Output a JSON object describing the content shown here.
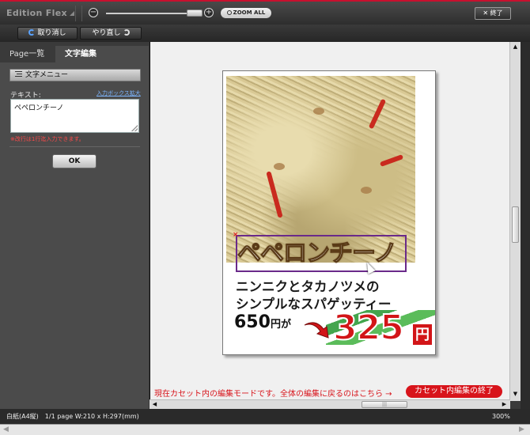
{
  "app": {
    "brand": "Edition Flex",
    "zoom_minus": "−",
    "zoom_plus": "+",
    "zoom_all_label": "ZOOM ALL",
    "exit_label": "✕ 終了"
  },
  "toolbar": {
    "undo_label": "取り消し",
    "redo_label": "やり直し"
  },
  "left_panel": {
    "tabs": [
      {
        "label": "Page一覧",
        "active": false
      },
      {
        "label": "文字編集",
        "active": true
      }
    ],
    "text_menu_label": "文字メニュー",
    "text_label": "テキスト:",
    "expand_link": "入力ボックス拡大",
    "text_value": "ペペロンチーノ",
    "note": "※改行は1行迄入力できます。",
    "ok_label": "OK"
  },
  "document": {
    "title": "ペペロンチーノ",
    "desc_line1": "ニンニクとタカノツメの",
    "desc_line2": "シンプルなスパゲッティー",
    "orig_price": "650",
    "orig_unit": "円が",
    "sale_price": "325",
    "sale_unit": "円",
    "close_mark": "×"
  },
  "notice": {
    "text": "現在カセット内の編集モードです。全体の編集に戻るのはこちら →",
    "button": "カセット内編集の終了"
  },
  "status": {
    "paper": "白紙(A4縦)　1/1 page W:210 x H:297(mm)",
    "zoom": "300%"
  },
  "scroll": {
    "up": "▲",
    "down": "▼",
    "left": "◀",
    "right": "▶",
    "grip": "|||"
  },
  "colors": {
    "accent_red": "#d8141b",
    "selection_purple": "#6a2a8a",
    "link_blue": "#7db7ff"
  }
}
